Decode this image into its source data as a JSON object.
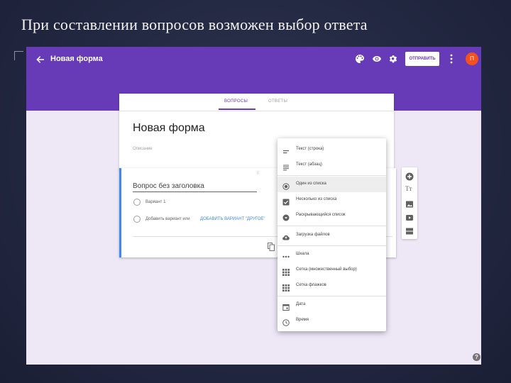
{
  "slide": {
    "title": "При составлении вопросов возможен выбор ответа"
  },
  "appbar": {
    "form_title": "Новая форма",
    "send_label": "ОТПРАВИТЬ",
    "avatar_letter": "П",
    "accent_color": "#673ab7"
  },
  "form": {
    "tabs": [
      {
        "label": "ВОПРОСЫ"
      },
      {
        "label": "ОТВЕТЫ"
      }
    ],
    "title": "Новая форма",
    "description_placeholder": "Описание"
  },
  "question": {
    "title": "Вопрос без заголовка",
    "options": [
      {
        "label": "Вариант 1"
      }
    ],
    "add_option_label": "Добавить вариант или",
    "add_other_label": "ДОБАВИТЬ ВАРИАНТ \"ДРУГОЕ\""
  },
  "question_type_menu": {
    "items": [
      {
        "label": "Текст (строка)",
        "icon": "short-text-icon"
      },
      {
        "label": "Текст (абзац)",
        "icon": "paragraph-icon"
      },
      {
        "label": "Один из списка",
        "icon": "radio-icon",
        "selected": true
      },
      {
        "label": "Несколько из списка",
        "icon": "checkbox-icon"
      },
      {
        "label": "Раскрывающийся список",
        "icon": "dropdown-icon"
      },
      {
        "label": "Загрузка файлов",
        "icon": "upload-icon"
      },
      {
        "label": "Шкала",
        "icon": "scale-icon"
      },
      {
        "label": "Сетка (множественный выбор)",
        "icon": "grid-icon"
      },
      {
        "label": "Сетка флажков",
        "icon": "checkbox-grid-icon"
      },
      {
        "label": "Дата",
        "icon": "calendar-icon"
      },
      {
        "label": "Время",
        "icon": "clock-icon"
      }
    ]
  },
  "side_toolbar": {
    "icons": [
      "add-question-icon",
      "title-text-icon",
      "image-icon",
      "video-icon",
      "section-icon"
    ],
    "title_glyph": "Тт"
  },
  "help": {
    "glyph": "?"
  }
}
